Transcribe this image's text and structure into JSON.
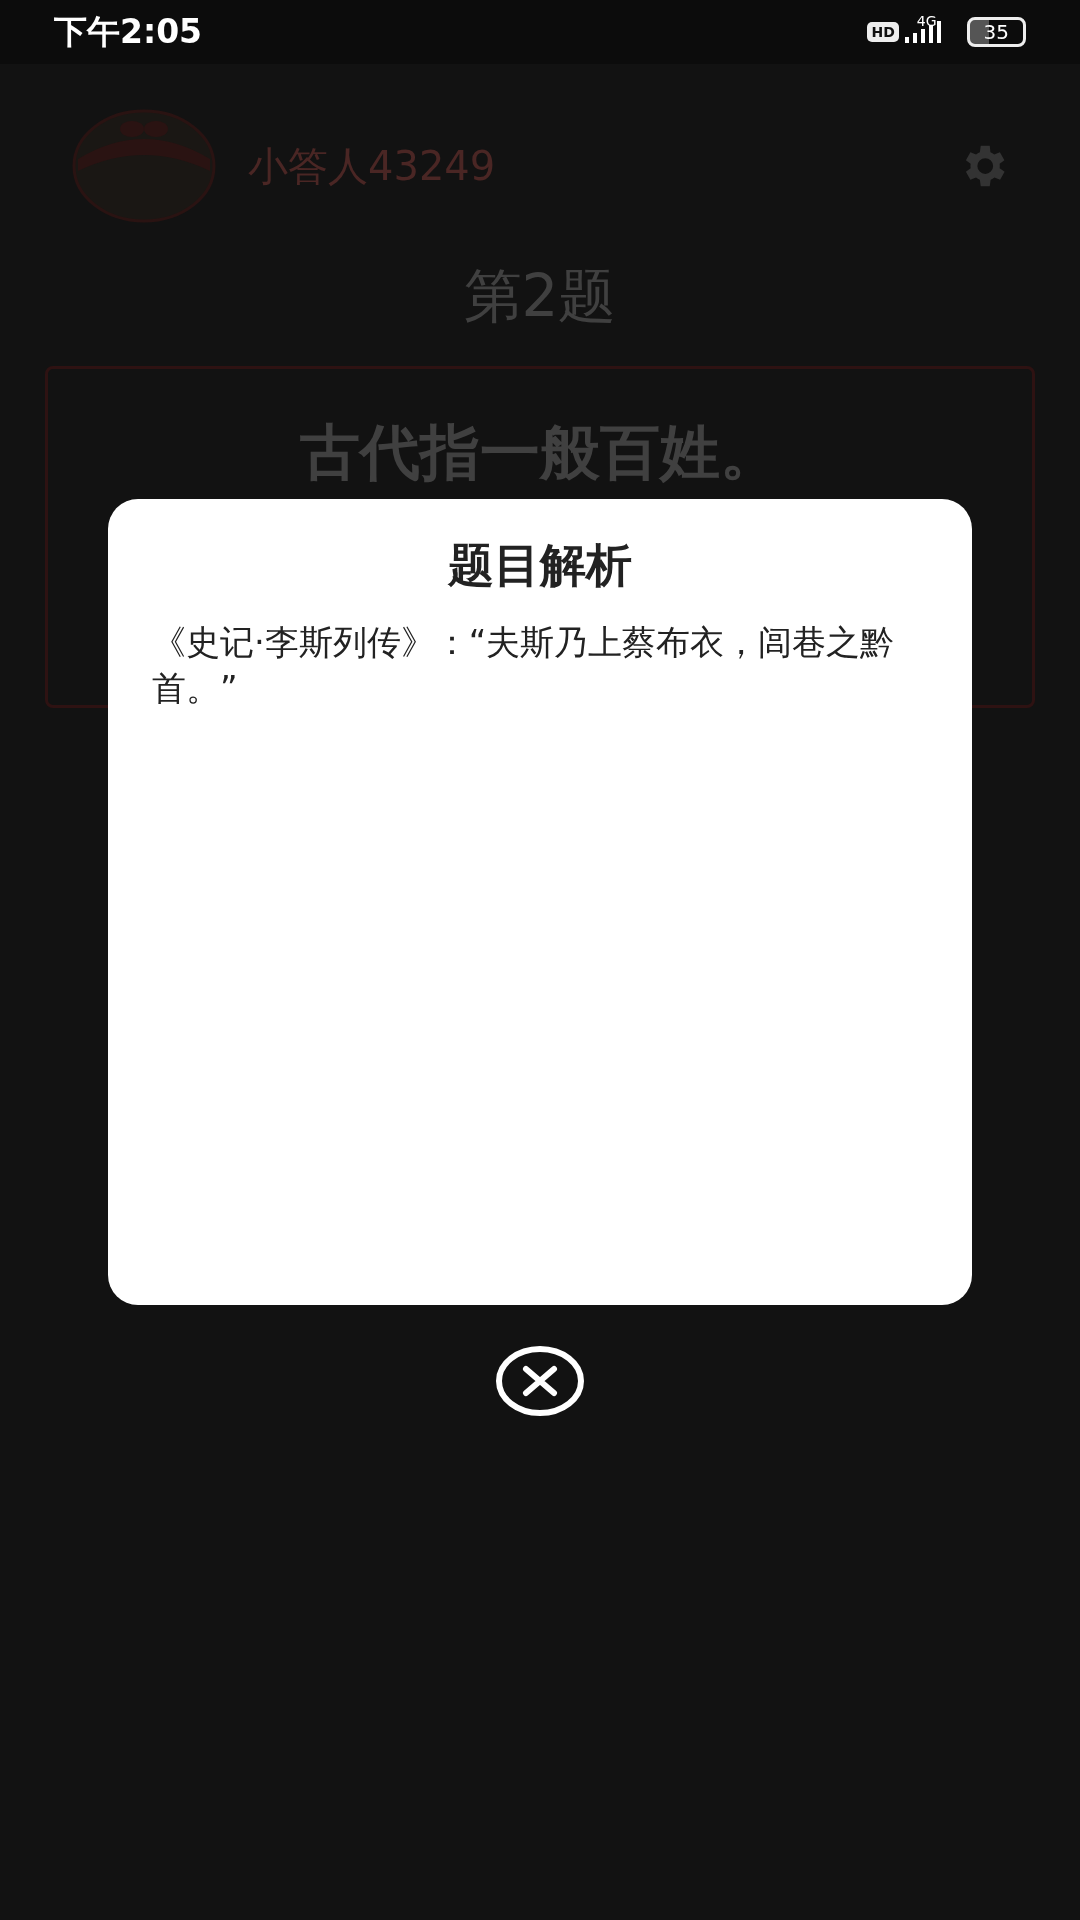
{
  "status_bar": {
    "time": "下午2:05",
    "hd_badge": "HD",
    "network": "4G",
    "battery": "35"
  },
  "profile": {
    "username": "小答人43249"
  },
  "question": {
    "number": "第2题",
    "prompt": "古代指一般百姓。"
  },
  "dialog": {
    "title": "题目解析",
    "body": "《史记·李斯列传》：“夫斯乃上蔡布衣，闾巷之黔首。”"
  }
}
